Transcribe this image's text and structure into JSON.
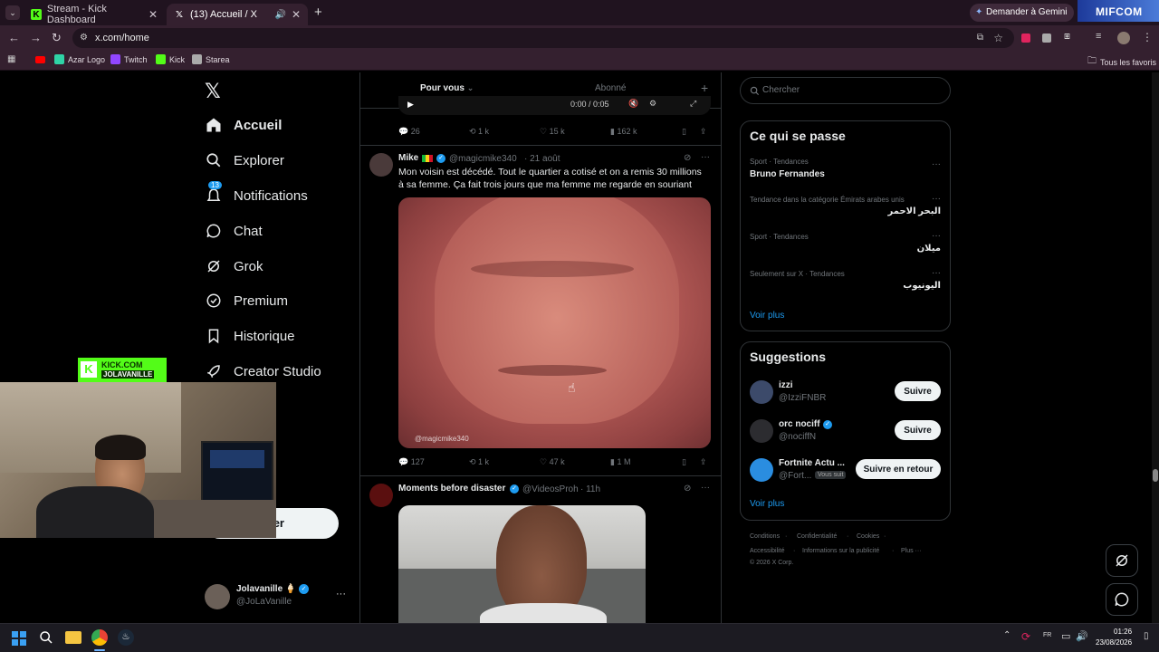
{
  "browser": {
    "tabs": [
      {
        "title": "Stream - Kick Dashboard"
      },
      {
        "title": "(13) Accueil / X"
      }
    ],
    "gemini_button": "Demander à Gemini",
    "brand_badge": "MIFCOM",
    "url": "x.com/home",
    "bookmarks": [
      "Azar Logo",
      "Twitch",
      "Kick",
      "Starea"
    ],
    "bookmarks_folder": "Tous les favoris"
  },
  "sidebar": {
    "logo": "x-logo",
    "items": [
      {
        "label": "Accueil",
        "icon": "home-icon"
      },
      {
        "label": "Explorer",
        "icon": "search-icon"
      },
      {
        "label": "Notifications",
        "icon": "bell-icon",
        "badge": "13"
      },
      {
        "label": "Chat",
        "icon": "chat-icon"
      },
      {
        "label": "Grok",
        "icon": "grok-icon"
      },
      {
        "label": "Premium",
        "icon": "premium-icon"
      },
      {
        "label": "Historique",
        "icon": "bookmark-icon"
      },
      {
        "label": "Creator Studio",
        "icon": "rocket-icon"
      }
    ],
    "post_button_partial": "er",
    "account": {
      "name": "Jolavanille 🍦",
      "handle": "@JoLaVanille"
    }
  },
  "overlay": {
    "kick_line1": "KICK.COM",
    "kick_line2": "JOLAVANILLE"
  },
  "feed": {
    "tabs": [
      {
        "label": "Pour vous"
      },
      {
        "label": "Abonné"
      }
    ],
    "add_tab": "+",
    "prev_tweet": {
      "video_time": "0:00 / 0:05",
      "actions": {
        "replies": "26",
        "retweets": "1 k",
        "likes": "15 k",
        "views": "162 k"
      }
    },
    "tweets": [
      {
        "name": "Mike",
        "handle": "@magicmike340",
        "time": "· 21 août",
        "text": "Mon voisin est décédé. Tout le quartier a cotisé et on a remis 30 millions à sa femme. Ça fait trois jours que ma femme me regarde en souriant",
        "watermark": "@magicmike340",
        "actions": {
          "replies": "127",
          "retweets": "1 k",
          "likes": "47 k",
          "views": "1 M"
        }
      },
      {
        "name": "Moments before disaster",
        "handle": "@VideosProh",
        "time": "· 11h"
      }
    ]
  },
  "right": {
    "search_placeholder": "Chercher",
    "trends_title": "Ce qui se passe",
    "trends": [
      {
        "meta": "Sport · Tendances",
        "name": "Bruno Fernandes"
      },
      {
        "meta": "Tendance dans la catégorie Émirats arabes unis",
        "name": "البحر الاحمر"
      },
      {
        "meta": "Sport · Tendances",
        "name": "ميلان"
      },
      {
        "meta": "Seulement sur X · Tendances",
        "name": "اليونيوب"
      }
    ],
    "trends_more": "Voir plus",
    "suggestions_title": "Suggestions",
    "suggestions": [
      {
        "name": "izzi",
        "handle": "@IzziFNBR",
        "button": "Suivre"
      },
      {
        "name": "orc nociff",
        "handle": "@nociffN",
        "button": "Suivre"
      },
      {
        "name": "Fortnite Actu ...",
        "handle": "@Fort...",
        "follows_you": "Vous suit",
        "button": "Suivre en retour"
      }
    ],
    "suggestions_more": "Voir plus",
    "footer": [
      "Conditions",
      "Confidentialité",
      "Cookies",
      "Accessibilité",
      "Informations sur la publicité",
      "Plus ···",
      "© 2026 X Corp."
    ]
  },
  "taskbar": {
    "time": "01:26",
    "date": "23/08/2026"
  },
  "colors": {
    "accent": "#1d9bf0",
    "kick_green": "#53fc18",
    "chrome_bg": "#34202f"
  }
}
